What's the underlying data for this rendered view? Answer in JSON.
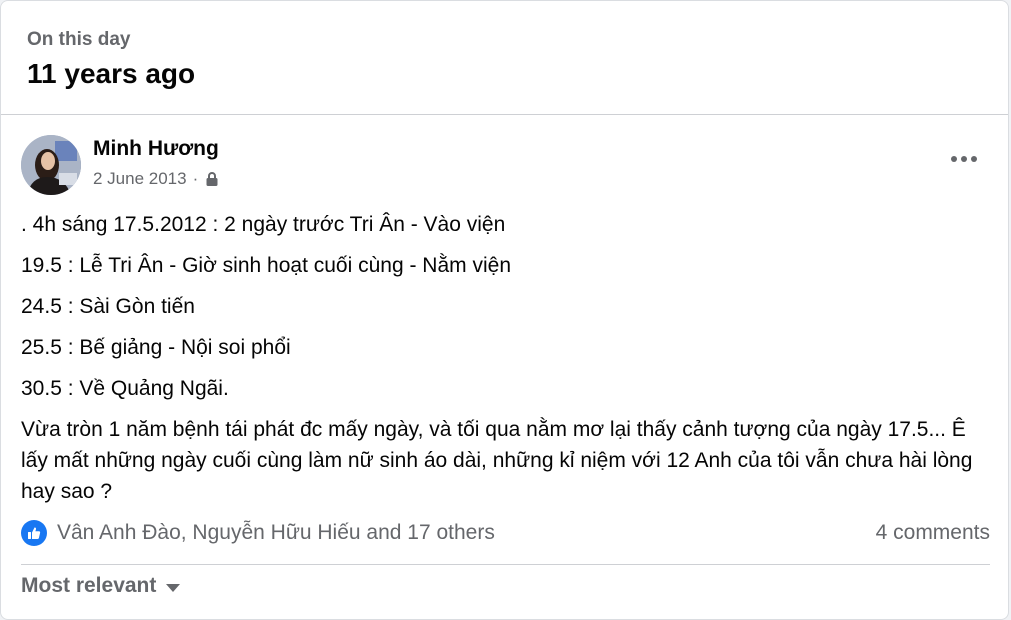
{
  "header": {
    "subtitle": "On this day",
    "title": "11 years ago"
  },
  "post": {
    "author": "Minh Hương",
    "date": "2 June 2013",
    "separator": "·",
    "privacy_icon": "lock-icon",
    "more_icon": "more-horizontal-icon",
    "lines": [
      ". 4h sáng 17.5.2012 : 2 ngày trước Tri Ân - Vào viện",
      "19.5 : Lễ Tri Ân - Giờ sinh hoạt cuối cùng - Nằm viện",
      "24.5 : Sài Gòn tiến",
      "25.5 : Bế giảng - Nội soi phổi",
      "30.5 : Về Quảng Ngãi.",
      "Vừa tròn 1 năm bệnh tái phát đc mấy ngày, và tối qua nằm mơ lại thấy cảnh tượng của ngày 17.5... Ê lấy mất những ngày cuối cùng làm nữ sinh áo dài, những kỉ niệm với 12 Anh của tôi vẫn chưa hài lòng hay sao ?"
    ],
    "reactions_text": "Vân Anh Đào, Nguyễn Hữu Hiếu and 17 others",
    "reaction_icon": "like-icon",
    "comments_count": "4 comments",
    "sort_label": "Most relevant"
  },
  "colors": {
    "accent": "#1877f2",
    "secondary_text": "#65676b",
    "primary_text": "#050505",
    "divider": "#ced0d4"
  }
}
